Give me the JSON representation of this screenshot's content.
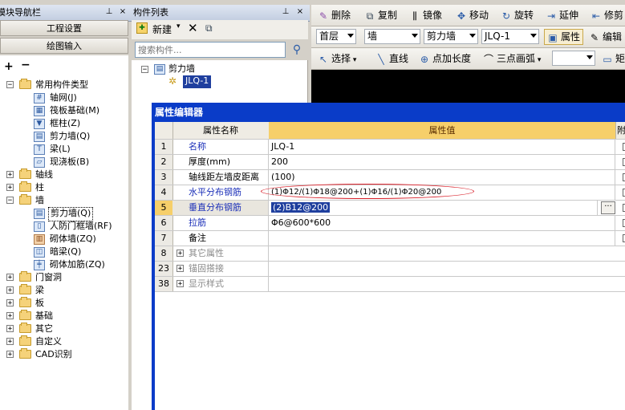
{
  "nav_panel": {
    "title": "模块导航栏",
    "buttons": [
      "工程设置",
      "绘图输入"
    ],
    "tree": [
      {
        "label": "常用构件类型",
        "expanded": true,
        "children": [
          {
            "label": "轴网(J)"
          },
          {
            "label": "筏板基础(M)"
          },
          {
            "label": "框柱(Z)"
          },
          {
            "label": "剪力墙(Q)"
          },
          {
            "label": "梁(L)"
          },
          {
            "label": "现浇板(B)"
          }
        ]
      },
      {
        "label": "轴线",
        "expanded": false
      },
      {
        "label": "柱",
        "expanded": false
      },
      {
        "label": "墙",
        "expanded": true,
        "children": [
          {
            "label": "剪力墙(Q)",
            "selected": true
          },
          {
            "label": "人防门框墙(RF)"
          },
          {
            "label": "砌体墙(ZQ)"
          },
          {
            "label": "暗梁(Q)"
          },
          {
            "label": "砌体加筋(ZQ)"
          }
        ]
      },
      {
        "label": "门窗洞",
        "expanded": false
      },
      {
        "label": "梁",
        "expanded": false
      },
      {
        "label": "板",
        "expanded": false
      },
      {
        "label": "基础",
        "expanded": false
      },
      {
        "label": "其它",
        "expanded": false
      },
      {
        "label": "自定义",
        "expanded": false
      },
      {
        "label": "CAD识别",
        "expanded": false
      }
    ]
  },
  "component_list": {
    "title": "构件列表",
    "new_label": "新建",
    "search_placeholder": "搜索构件...",
    "group": "剪力墙",
    "item": "JLQ-1"
  },
  "toolbar": {
    "row1": [
      "删除",
      "复制",
      "镜像",
      "移动",
      "旋转",
      "延伸",
      "修剪"
    ],
    "floor": "首层",
    "category": "墙",
    "type": "剪力墙",
    "component": "JLQ-1",
    "properties_label": "属性",
    "edit_label": "编辑",
    "row3": [
      "选择",
      "直线",
      "点加长度",
      "三点画弧"
    ],
    "rect_label": "矩"
  },
  "property_editor": {
    "title": "属性编辑器",
    "headers": {
      "name": "属性名称",
      "value": "属性值",
      "extra": "附"
    },
    "rows": [
      {
        "num": "1",
        "name": "名称",
        "value": "JLQ-1",
        "style": "blue"
      },
      {
        "num": "2",
        "name": "厚度(mm)",
        "value": "200",
        "style": "black"
      },
      {
        "num": "3",
        "name": "轴线距左墙皮距离",
        "value": "(100)",
        "style": "black"
      },
      {
        "num": "4",
        "name": "水平分布钢筋",
        "value": "(1)Φ12/(1)Φ18@200+(1)Φ16/(1)Φ20@200",
        "style": "blue"
      },
      {
        "num": "5",
        "name": "垂直分布钢筋",
        "value": "(2)B12@200",
        "style": "blue"
      },
      {
        "num": "6",
        "name": "拉筋",
        "value": "Φ6@600*600",
        "style": "blue"
      },
      {
        "num": "7",
        "name": "备注",
        "value": "",
        "style": "black"
      },
      {
        "num": "8",
        "name": "其它属性",
        "value": "",
        "style": "gray"
      },
      {
        "num": "23",
        "name": "锚固搭接",
        "value": "",
        "style": "gray"
      },
      {
        "num": "38",
        "name": "显示样式",
        "value": "",
        "style": "gray"
      }
    ]
  }
}
